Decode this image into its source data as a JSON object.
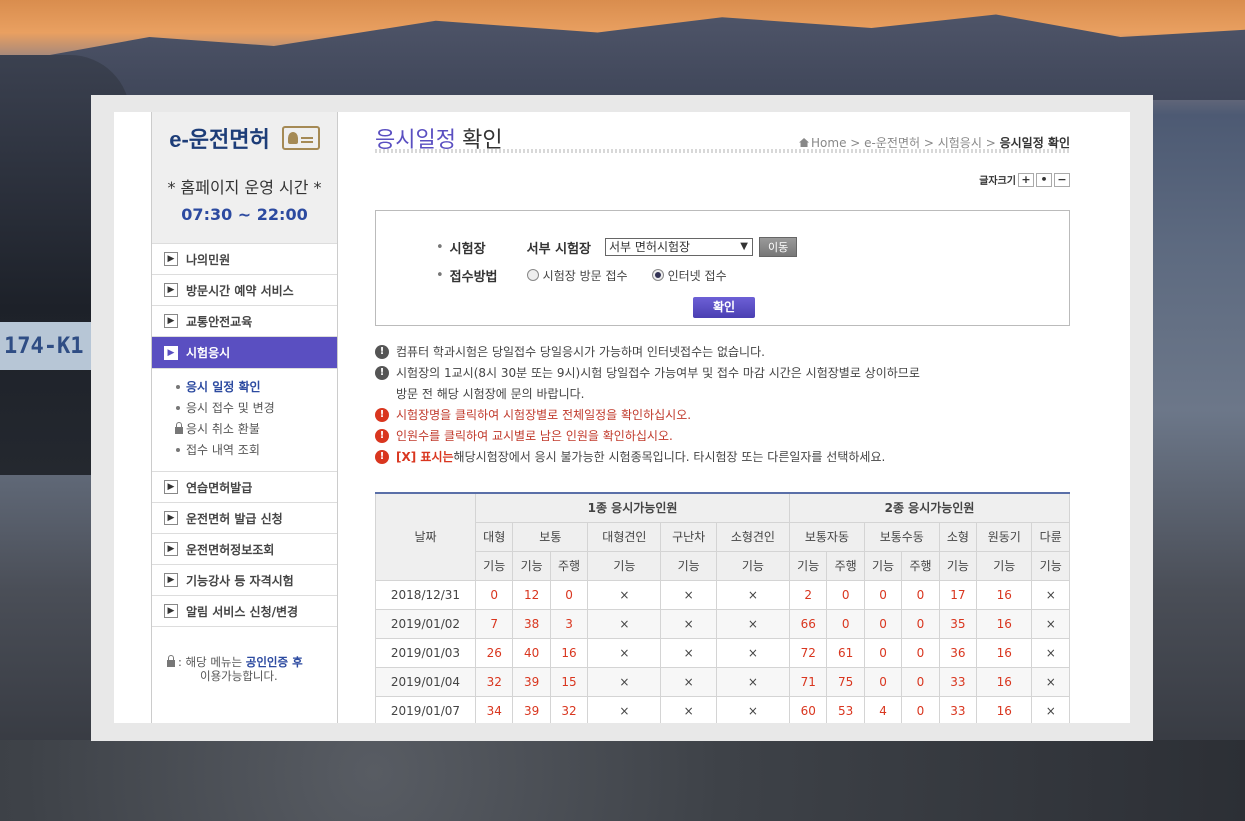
{
  "sidebar": {
    "logo_text": "e-운전면허",
    "hours_title": "* 홈페이지 운영 시간 *",
    "hours": "07:30 ~ 22:00",
    "menu_top": [
      "나의민원",
      "방문시간 예약 서비스",
      "교통안전교육"
    ],
    "active": "시험응시",
    "submenu": [
      "응시 일정 확인",
      "응시 접수 및 변경",
      "응시 취소 환불",
      "접수 내역 조회"
    ],
    "menu_bottom": [
      "연습면허발급",
      "운전면허 발급 신청",
      "운전면허정보조회",
      "기능강사 등 자격시험",
      "알림 서비스 신청/변경"
    ],
    "note_prefix": ": 해당 메뉴는 ",
    "note_bold": "공인인증 후",
    "note_suffix": "이용가능합니다."
  },
  "header": {
    "title_accent": "응시일정",
    "title_rest": " 확인",
    "breadcrumb": [
      "Home",
      "e-운전면허",
      "시험응시",
      "응시일정 확인"
    ],
    "font_size_label": "글자크기",
    "font_buttons": [
      "+",
      "•",
      "−"
    ]
  },
  "form": {
    "site_label": "시험장",
    "site_name": "서부 시험장",
    "site_select": "서부 면허시험장",
    "move_button": "이동",
    "method_label": "접수방법",
    "method_options": [
      "시험장 방문 접수",
      "인터넷 접수"
    ],
    "confirm_button": "확인"
  },
  "notices": [
    "컴퓨터 학과시험은 당일접수 당일응시가 가능하며 인터넷접수는 없습니다.",
    "시험장의 1교시(8시 30분 또는 9시)시험 당일접수 가능여부 및 접수 마감 시간은 시험장별로 상이하므로",
    "방문 전 해당 시험장에 문의 바랍니다.",
    "시험장명을 클릭하여 시험장별로 전체일정을 확인하십시오.",
    "인원수를 클릭하여 교시별로 남은 인원을 확인하십시오.",
    "[X] 표시는",
    " 해당시험장에서 응시 불가능한 시험종목입니다. 타시험장 또는 다른일자를 선택하세요."
  ],
  "table": {
    "date_header": "날짜",
    "group1": "1종 응시가능인원",
    "group2": "2종 응시가능인원",
    "types": [
      "대형",
      "보통",
      "대형견인",
      "구난차",
      "소형견인",
      "보통자동",
      "보통수동",
      "소형",
      "원동기",
      "다륜"
    ],
    "sub": [
      "기능",
      "기능",
      "주행",
      "기능",
      "기능",
      "기능",
      "기능",
      "주행",
      "기능",
      "주행",
      "기능",
      "기능",
      "기능"
    ],
    "rows": [
      [
        "2018/12/31",
        "0",
        "12",
        "0",
        "×",
        "×",
        "×",
        "2",
        "0",
        "0",
        "0",
        "17",
        "16",
        "×"
      ],
      [
        "2019/01/02",
        "7",
        "38",
        "3",
        "×",
        "×",
        "×",
        "66",
        "0",
        "0",
        "0",
        "35",
        "16",
        "×"
      ],
      [
        "2019/01/03",
        "26",
        "40",
        "16",
        "×",
        "×",
        "×",
        "72",
        "61",
        "0",
        "0",
        "36",
        "16",
        "×"
      ],
      [
        "2019/01/04",
        "32",
        "39",
        "15",
        "×",
        "×",
        "×",
        "71",
        "75",
        "0",
        "0",
        "33",
        "16",
        "×"
      ],
      [
        "2019/01/07",
        "34",
        "39",
        "32",
        "×",
        "×",
        "×",
        "60",
        "53",
        "4",
        "0",
        "33",
        "16",
        "×"
      ]
    ]
  },
  "desktop": {
    "plate_text": "174-K1"
  }
}
